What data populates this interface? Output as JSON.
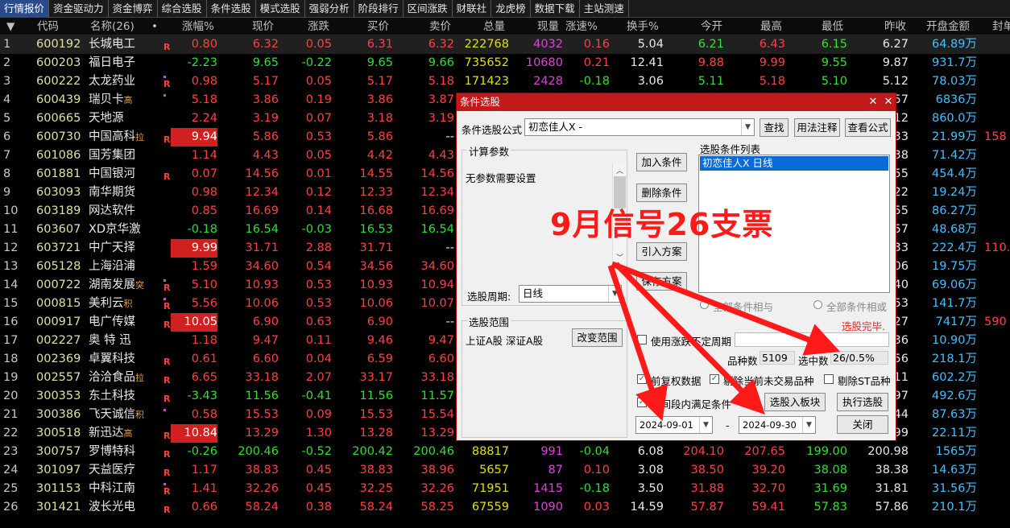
{
  "tabs": [
    "行情报价",
    "资金驱动力",
    "资金博弈",
    "综合选股",
    "条件选股",
    "模式选股",
    "强弱分析",
    "阶段排行",
    "区间涨跌",
    "财联社",
    "龙虎榜",
    "数据下载",
    "主站测速"
  ],
  "columns": {
    "sort": "▼",
    "code": "代码",
    "name": "名称(26)",
    "dot": "•",
    "chg": "涨幅%",
    "price": "现价",
    "zd": "涨跌",
    "buy": "买价",
    "sell": "卖价",
    "vol": "总量",
    "cur": "现量",
    "spd": "涨速%",
    "hs": "换手%",
    "open": "今开",
    "high": "最高",
    "low": "最低",
    "pre": "昨收",
    "amt": "开盘金额",
    "seal": "封单"
  },
  "rows": [
    {
      "i": "1",
      "code": "600192",
      "name": "长城电工",
      "sfx": "",
      "flag": "R",
      "chg": "0.80",
      "price": "6.32",
      "zd": "0.05",
      "buy": "6.31",
      "sell": "6.32",
      "vol": "222768",
      "cur": "4032",
      "spd": "0.16",
      "hs": "5.04",
      "open": "6.21",
      "high": "6.43",
      "low": "6.15",
      "pre": "6.27",
      "amt": "64.89万",
      "seal": ""
    },
    {
      "i": "2",
      "code": "600203",
      "name": "福日电子",
      "sfx": "",
      "flag": "",
      "chg": "-2.23",
      "price": "9.65",
      "zd": "-0.22",
      "buy": "9.65",
      "sell": "9.66",
      "vol": "735652",
      "cur": "10680",
      "spd": "0.21",
      "hs": "12.41",
      "open": "9.88",
      "high": "9.99",
      "low": "9.55",
      "pre": "9.87",
      "amt": "931.7万",
      "seal": ""
    },
    {
      "i": "3",
      "code": "600222",
      "name": "太龙药业",
      "sfx": "",
      "flag": "R•",
      "chg": "0.98",
      "price": "5.17",
      "zd": "0.05",
      "buy": "5.17",
      "sell": "5.18",
      "vol": "171423",
      "cur": "2428",
      "spd": "-0.18",
      "hs": "3.06",
      "open": "5.11",
      "high": "5.18",
      "low": "5.10",
      "pre": "5.12",
      "amt": "78.03万",
      "seal": ""
    },
    {
      "i": "4",
      "code": "600439",
      "name": "瑞贝卡",
      "sfx": "高",
      "flag": "•",
      "chg": "5.18",
      "price": "3.86",
      "zd": "0.19",
      "buy": "3.86",
      "sell": "3.87",
      "vol": "",
      "cur": "",
      "spd": "",
      "hs": "",
      "open": "",
      "high": "",
      "low": "",
      "pre": "57",
      "amt": "6836万",
      "seal": ""
    },
    {
      "i": "5",
      "code": "600665",
      "name": "天地源",
      "sfx": "",
      "flag": "",
      "chg": "2.24",
      "price": "3.19",
      "zd": "0.07",
      "buy": "3.18",
      "sell": "3.19",
      "vol": "",
      "cur": "",
      "spd": "",
      "hs": "",
      "open": "",
      "high": "",
      "low": "",
      "pre": "12",
      "amt": "860.0万",
      "seal": ""
    },
    {
      "i": "6",
      "code": "600730",
      "name": "中国高科",
      "sfx": "拉",
      "flag": "R",
      "chg": "9.94",
      "price": "5.86",
      "zd": "0.53",
      "buy": "5.86",
      "sell": "--",
      "vol": "",
      "cur": "",
      "spd": "",
      "hs": "",
      "open": "",
      "high": "",
      "low": "",
      "pre": "33",
      "amt": "21.99万",
      "seal": "158"
    },
    {
      "i": "7",
      "code": "601086",
      "name": "国芳集团",
      "sfx": "",
      "flag": "",
      "chg": "1.14",
      "price": "4.43",
      "zd": "0.05",
      "buy": "4.42",
      "sell": "4.43",
      "vol": "",
      "cur": "",
      "spd": "",
      "hs": "",
      "open": "",
      "high": "",
      "low": "",
      "pre": "38",
      "amt": "71.42万",
      "seal": ""
    },
    {
      "i": "8",
      "code": "601881",
      "name": "中国银河",
      "sfx": "",
      "flag": "R",
      "chg": "0.07",
      "price": "14.56",
      "zd": "0.01",
      "buy": "14.55",
      "sell": "14.56",
      "vol": "",
      "cur": "",
      "spd": "",
      "hs": "",
      "open": "",
      "high": "",
      "low": "",
      "pre": "55",
      "amt": "454.4万",
      "seal": ""
    },
    {
      "i": "9",
      "code": "603093",
      "name": "南华期货",
      "sfx": "",
      "flag": "",
      "chg": "0.98",
      "price": "12.34",
      "zd": "0.12",
      "buy": "12.33",
      "sell": "12.34",
      "vol": "",
      "cur": "",
      "spd": "",
      "hs": "",
      "open": "",
      "high": "",
      "low": "",
      "pre": "22",
      "amt": "19.24万",
      "seal": ""
    },
    {
      "i": "10",
      "code": "603189",
      "name": "网达软件",
      "sfx": "",
      "flag": "",
      "chg": "0.85",
      "price": "16.69",
      "zd": "0.14",
      "buy": "16.68",
      "sell": "16.69",
      "vol": "",
      "cur": "",
      "spd": "",
      "hs": "",
      "open": "",
      "high": "",
      "low": "",
      "pre": "55",
      "amt": "86.27万",
      "seal": ""
    },
    {
      "i": "11",
      "code": "603607",
      "name": "XD京华激",
      "sfx": "",
      "flag": "",
      "chg": "-0.18",
      "price": "16.54",
      "zd": "-0.03",
      "buy": "16.53",
      "sell": "16.54",
      "vol": "",
      "cur": "",
      "spd": "",
      "hs": "",
      "open": "",
      "high": "",
      "low": "",
      "pre": "57",
      "amt": "48.68万",
      "seal": ""
    },
    {
      "i": "12",
      "code": "603721",
      "name": "中广天择",
      "sfx": "",
      "flag": "",
      "chg": "9.99",
      "price": "31.71",
      "zd": "2.88",
      "buy": "31.71",
      "sell": "--",
      "vol": "",
      "cur": "",
      "spd": "",
      "hs": "",
      "open": "",
      "high": "",
      "low": "",
      "pre": "33",
      "amt": "222.4万",
      "seal": "110."
    },
    {
      "i": "13",
      "code": "605128",
      "name": "上海沿浦",
      "sfx": "",
      "flag": "",
      "chg": "1.59",
      "price": "34.60",
      "zd": "0.54",
      "buy": "34.56",
      "sell": "34.60",
      "vol": "",
      "cur": "",
      "spd": "",
      "hs": "",
      "open": "",
      "high": "",
      "low": "",
      "pre": "06",
      "amt": "19.75万",
      "seal": ""
    },
    {
      "i": "14",
      "code": "000722",
      "name": "湖南发展",
      "sfx": "突",
      "flag": "R•",
      "chg": "5.10",
      "price": "10.93",
      "zd": "0.53",
      "buy": "10.93",
      "sell": "10.94",
      "vol": "",
      "cur": "",
      "spd": "",
      "hs": "",
      "open": "",
      "high": "",
      "low": "",
      "pre": "40",
      "amt": "69.06万",
      "seal": ""
    },
    {
      "i": "15",
      "code": "000815",
      "name": "美利云",
      "sfx": "积",
      "flag": "R•",
      "chg": "5.56",
      "price": "10.06",
      "zd": "0.53",
      "buy": "10.06",
      "sell": "10.07",
      "vol": "",
      "cur": "",
      "spd": "",
      "hs": "",
      "open": "",
      "high": "",
      "low": "",
      "pre": "53",
      "amt": "141.7万",
      "seal": ""
    },
    {
      "i": "16",
      "code": "000917",
      "name": "电广传媒",
      "sfx": "",
      "flag": "R",
      "chg": "10.05",
      "price": "6.90",
      "zd": "0.63",
      "buy": "6.90",
      "sell": "--",
      "vol": "",
      "cur": "",
      "spd": "",
      "hs": "",
      "open": "",
      "high": "",
      "low": "",
      "pre": "27",
      "amt": "7417万",
      "seal": "590"
    },
    {
      "i": "17",
      "code": "002227",
      "name": "奥 特 迅",
      "sfx": "",
      "flag": "",
      "chg": "1.18",
      "price": "9.47",
      "zd": "0.11",
      "buy": "9.46",
      "sell": "9.47",
      "vol": "",
      "cur": "",
      "spd": "",
      "hs": "",
      "open": "",
      "high": "",
      "low": "",
      "pre": "36",
      "amt": "10.90万",
      "seal": ""
    },
    {
      "i": "18",
      "code": "002369",
      "name": "卓翼科技",
      "sfx": "",
      "flag": "R",
      "chg": "0.61",
      "price": "6.60",
      "zd": "0.04",
      "buy": "6.59",
      "sell": "6.60",
      "vol": "",
      "cur": "",
      "spd": "",
      "hs": "",
      "open": "",
      "high": "",
      "low": "",
      "pre": "56",
      "amt": "218.1万",
      "seal": ""
    },
    {
      "i": "19",
      "code": "002557",
      "name": "洽洽食品",
      "sfx": "拉",
      "flag": "R",
      "chg": "6.65",
      "price": "33.18",
      "zd": "2.07",
      "buy": "33.17",
      "sell": "33.18",
      "vol": "",
      "cur": "",
      "spd": "",
      "hs": "",
      "open": "",
      "high": "",
      "low": "",
      "pre": "11",
      "amt": "602.2万",
      "seal": ""
    },
    {
      "i": "20",
      "code": "300353",
      "name": "东土科技",
      "sfx": "",
      "flag": "R",
      "chg": "-3.43",
      "price": "11.56",
      "zd": "-0.41",
      "buy": "11.56",
      "sell": "11.57",
      "vol": "",
      "cur": "",
      "spd": "",
      "hs": "",
      "open": "",
      "high": "",
      "low": "",
      "pre": "97",
      "amt": "492.6万",
      "seal": ""
    },
    {
      "i": "21",
      "code": "300386",
      "name": "飞天诚信",
      "sfx": "积",
      "flag": "•",
      "chg": "0.58",
      "price": "15.53",
      "zd": "0.09",
      "buy": "15.53",
      "sell": "15.54",
      "vol": "",
      "cur": "",
      "spd": "",
      "hs": "",
      "open": "",
      "high": "",
      "low": "",
      "pre": "44",
      "amt": "87.63万",
      "seal": ""
    },
    {
      "i": "22",
      "code": "300518",
      "name": "新迅达",
      "sfx": "高",
      "flag": "R",
      "chg": "10.84",
      "price": "13.29",
      "zd": "1.30",
      "buy": "13.28",
      "sell": "13.29",
      "vol": "",
      "cur": "",
      "spd": "",
      "hs": "",
      "open": "",
      "high": "",
      "low": "",
      "pre": "99",
      "amt": "22.11万",
      "seal": ""
    },
    {
      "i": "23",
      "code": "300757",
      "name": "罗博特科",
      "sfx": "",
      "flag": "R",
      "chg": "-0.26",
      "price": "200.46",
      "zd": "-0.52",
      "buy": "200.42",
      "sell": "200.46",
      "vol": "88817",
      "cur": "991",
      "spd": "-0.04",
      "hs": "6.08",
      "open": "204.10",
      "high": "207.65",
      "low": "199.00",
      "pre": "200.98",
      "amt": "1565万",
      "seal": ""
    },
    {
      "i": "24",
      "code": "301097",
      "name": "天益医疗",
      "sfx": "",
      "flag": "R",
      "chg": "1.17",
      "price": "38.83",
      "zd": "0.45",
      "buy": "38.83",
      "sell": "38.96",
      "vol": "5657",
      "cur": "87",
      "spd": "0.10",
      "hs": "3.08",
      "open": "38.50",
      "high": "39.20",
      "low": "38.08",
      "pre": "38.38",
      "amt": "14.63万",
      "seal": ""
    },
    {
      "i": "25",
      "code": "301153",
      "name": "中科江南",
      "sfx": "",
      "flag": "R•",
      "chg": "1.41",
      "price": "32.26",
      "zd": "0.45",
      "buy": "32.25",
      "sell": "32.26",
      "vol": "71951",
      "cur": "1415",
      "spd": "-0.18",
      "hs": "3.50",
      "open": "31.88",
      "high": "32.70",
      "low": "31.69",
      "pre": "31.81",
      "amt": "31.56万",
      "seal": ""
    },
    {
      "i": "26",
      "code": "301421",
      "name": "波长光电",
      "sfx": "",
      "flag": "R",
      "chg": "0.66",
      "price": "58.24",
      "zd": "0.38",
      "buy": "58.24",
      "sell": "58.25",
      "vol": "67559",
      "cur": "1090",
      "spd": "0.03",
      "hs": "14.59",
      "open": "57.87",
      "high": "59.41",
      "low": "57.83",
      "pre": "57.86",
      "amt": "210.1万",
      "seal": ""
    }
  ],
  "dialog": {
    "title": "条件选股",
    "formula_label": "条件选股公式",
    "formula_value": "初恋佳人X  -",
    "btn_find": "查找",
    "btn_usage": "用法注释",
    "btn_view": "查看公式",
    "calc_group": "计算参数",
    "no_params": "无参数需要设置",
    "btn_add": "加入条件",
    "btn_delete": "删除条件",
    "btn_import": "引入方案",
    "btn_save": "保存方案",
    "list_label": "选股条件列表",
    "list_item": "初恋佳人X  日线",
    "period_label": "选股周期:",
    "period_value": "日线",
    "radio_and": "全部条件相与",
    "radio_or": "全部条件相或",
    "done_text": "选股完毕.",
    "range_group": "选股范围",
    "range_value": "上证A股 深证A股",
    "btn_change_range": "改变范围",
    "chk_uncertain": "使用涨跌不定周期",
    "count_label": "品种数",
    "count_value": "5109",
    "selected_label": "选中数",
    "selected_value": "26/0.5%",
    "chk_rights": "前复权数据",
    "chk_untraded": "剔除当前未交易品种",
    "chk_st": "剔除ST品种",
    "chk_time": "时间段内满足条件",
    "btn_to_block": "选股入板块",
    "btn_exec": "执行选股",
    "date_from": "2024-09-01",
    "date_to": "2024-09-30",
    "date_dash": "-",
    "btn_close": "关闭"
  },
  "overlay": "9月信号26支票"
}
